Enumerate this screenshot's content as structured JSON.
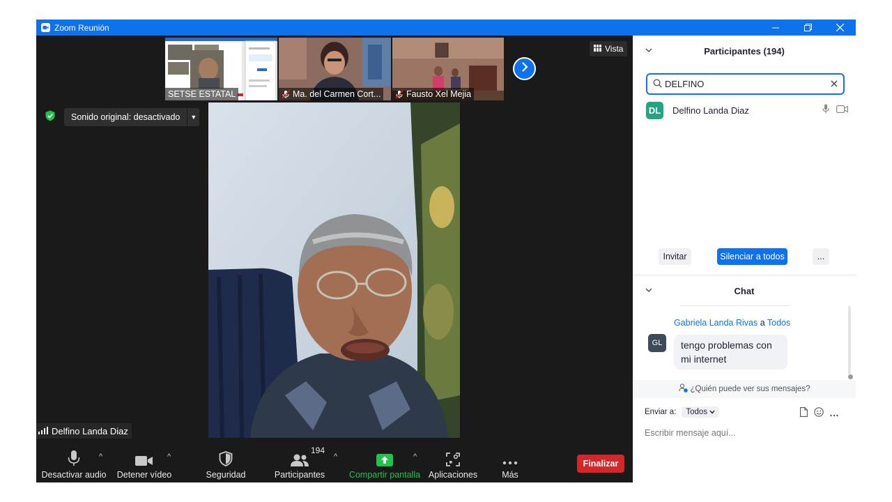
{
  "window": {
    "title": "Zoom Reunión"
  },
  "thumbnails": [
    {
      "name": "SETSE ESTATAL",
      "muted": false
    },
    {
      "name": "Ma. del Carmen Cort...",
      "muted": true
    },
    {
      "name": "Fausto Xel Mejia",
      "muted": true
    }
  ],
  "view_button": {
    "label": "Vista"
  },
  "original_sound": {
    "label": "Sonido original: desactivado"
  },
  "main_video": {
    "name": "Delfino Landa Diaz"
  },
  "toolbar": {
    "mute": "Desactivar audio",
    "video": "Detener vídeo",
    "security": "Seguridad",
    "participants": "Participantes",
    "participants_count": "194",
    "share": "Compartir pantalla",
    "apps": "Aplicaciones",
    "more": "Más",
    "end": "Finalizar"
  },
  "participants_panel": {
    "title": "Participantes (194)",
    "search_value": "DELFINO",
    "results": [
      {
        "initials": "DL",
        "name": "Delfino Landa Diaz",
        "avatar_color": "#23a584"
      }
    ],
    "invite": "Invitar",
    "mute_all": "Silenciar a todos",
    "more": "..."
  },
  "chat": {
    "title": "Chat",
    "messages": [
      {
        "initials": "GL",
        "from": "Gabriela Landa Rivas",
        "to_word": "a",
        "to": "Todos",
        "text": "tengo problemas con mi internet"
      }
    ],
    "who_can_see": "¿Quién puede ver sus mensajes?",
    "send_to_label": "Enviar a:",
    "send_to_value": "Todos",
    "input_placeholder": "Escribir mensaje aquí..."
  },
  "colors": {
    "accent": "#0e72ed",
    "end": "#d6262a",
    "share": "#23c24f",
    "avatar_dl": "#23a584",
    "avatar_gl": "#3c4a59"
  }
}
